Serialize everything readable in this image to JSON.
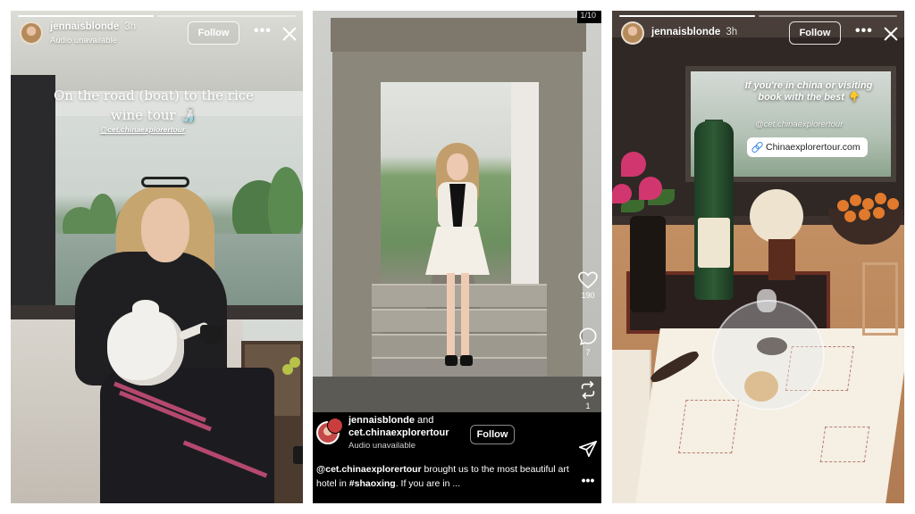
{
  "colors": {
    "follow_border": "#ffffff",
    "link_blue": "#2f7ee6",
    "reel_bg": "#000000"
  },
  "story_left": {
    "username": "jennaisblonde",
    "time": "3h",
    "audio_status": "Audio unavailable",
    "follow_label": "Follow",
    "more_icon": "ellipsis-icon",
    "close_icon": "close-icon",
    "progress": [
      1.0,
      0.0
    ],
    "overlay_text": "On the road (boat) to the rice wine tour 🍶",
    "mention": "@cet.chinaexplorertour"
  },
  "reel_center": {
    "page_counter": "1/10",
    "likes": "190",
    "comments": "7",
    "reposts": "1",
    "author": "jennaisblonde",
    "and_label": "and",
    "collaborator": "cet.chinaexplorertour",
    "audio_status": "Audio unavailable",
    "follow_label": "Follow",
    "caption_mention": "@cet.chinaexplorertour",
    "caption_text_1": " brought us to the most beautiful art hotel in ",
    "caption_hashtag": "#shaoxing",
    "caption_text_2": ". If you are in ..."
  },
  "story_right": {
    "username": "jennaisblonde",
    "time": "3h",
    "follow_label": "Follow",
    "more_icon": "ellipsis-icon",
    "close_icon": "close-icon",
    "progress": [
      1.0,
      0.0
    ],
    "overlay_text": "If you're in china or visiting book with the best 👇",
    "mention": "@cet.chinaexplorertour",
    "link_label": "Chinaexplorertour.com",
    "link_icon": "link-icon"
  }
}
